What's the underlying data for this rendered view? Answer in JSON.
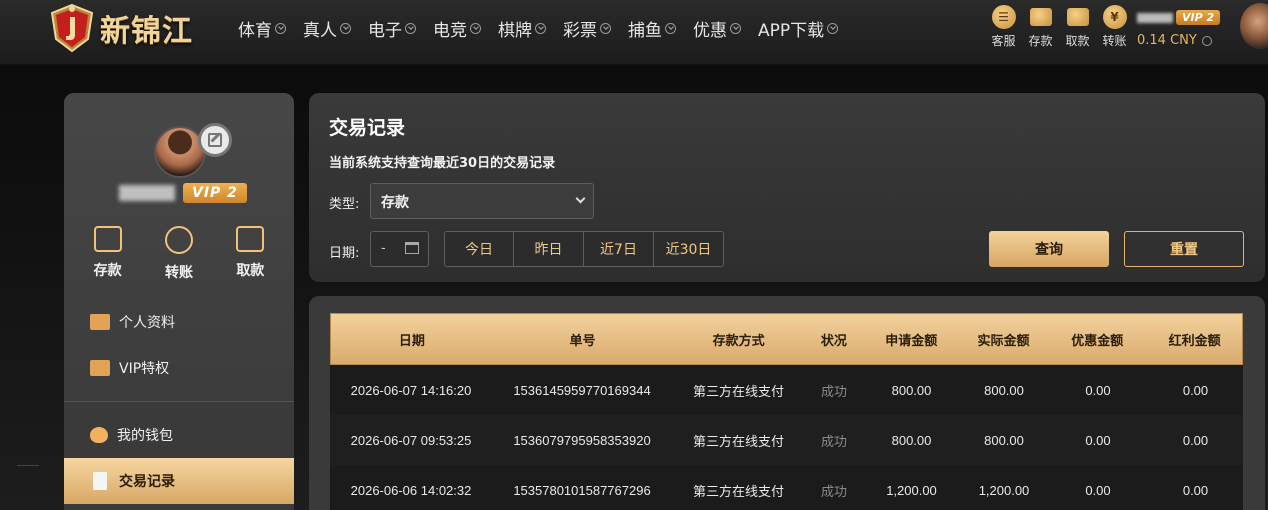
{
  "header": {
    "logo_text": "新锦江",
    "nav": [
      "体育",
      "真人",
      "电子",
      "电竞",
      "棋牌",
      "彩票",
      "捕鱼",
      "优惠",
      "APP下载"
    ],
    "actions": [
      {
        "label": "客服",
        "icon": "customer-service-icon"
      },
      {
        "label": "存款",
        "icon": "wallet-icon"
      },
      {
        "label": "取款",
        "icon": "withdraw-icon"
      },
      {
        "label": "转账",
        "icon": "transfer-icon"
      }
    ],
    "vip": "VIP 2",
    "balance": "0.14 CNY"
  },
  "sidebar": {
    "vip": "VIP 2",
    "quick": [
      {
        "label": "存款",
        "icon": "wallet-icon"
      },
      {
        "label": "转账",
        "icon": "transfer-icon"
      },
      {
        "label": "取款",
        "icon": "card-icon"
      }
    ],
    "menu": [
      {
        "label": "个人资料",
        "icon": "profile-card-icon"
      },
      {
        "label": "VIP特权",
        "icon": "vip-card-icon"
      },
      {
        "label": "我的钱包",
        "icon": "piggy-bank-icon"
      },
      {
        "label": "交易记录",
        "icon": "document-icon",
        "active": true
      }
    ]
  },
  "filter": {
    "title": "交易记录",
    "subtitle": "当前系统支持查询最近30日的交易记录",
    "type_label": "类型:",
    "type_value": "存款",
    "date_label": "日期:",
    "date_value": "-",
    "ranges": [
      "今日",
      "昨日",
      "近7日",
      "近30日"
    ],
    "query_label": "查询",
    "reset_label": "重置"
  },
  "table": {
    "headers": [
      "日期",
      "单号",
      "存款方式",
      "状况",
      "申请金额",
      "实际金额",
      "优惠金额",
      "红利金额"
    ],
    "rows": [
      [
        "2026-06-07 14:16:20",
        "1536145959770169344",
        "第三方在线支付",
        "成功",
        "800.00",
        "800.00",
        "0.00",
        "0.00"
      ],
      [
        "2026-06-07 09:53:25",
        "1536079795958353920",
        "第三方在线支付",
        "成功",
        "800.00",
        "800.00",
        "0.00",
        "0.00"
      ],
      [
        "2026-06-06 14:02:32",
        "1535780101587767296",
        "第三方在线支付",
        "成功",
        "1,200.00",
        "1,200.00",
        "0.00",
        "0.00"
      ]
    ]
  },
  "colors": {
    "accent_gold": "#e4b36d",
    "panel_bg": "#3a3a3a",
    "status_muted": "#8a8a8a"
  }
}
